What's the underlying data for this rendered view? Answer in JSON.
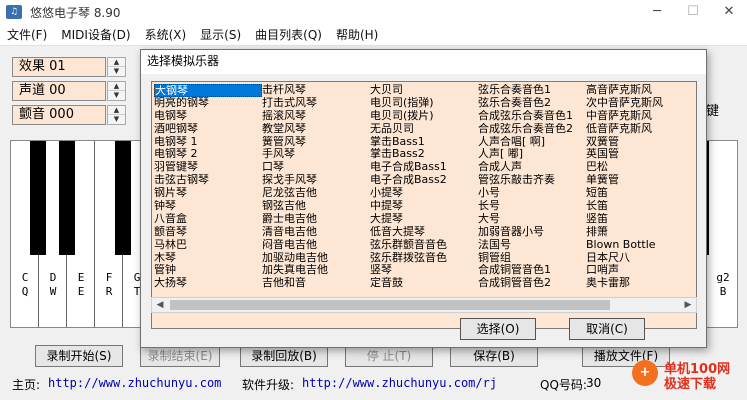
{
  "window": {
    "title": "悠悠电子琴 8.90",
    "app_icon": "piano-app-icon"
  },
  "menu": [
    "文件(F)",
    "MIDI设备(D)",
    "系统(X)",
    "显示(S)",
    "曲目列表(Q)",
    "帮助(H)"
  ],
  "controls": [
    {
      "label": "效果",
      "value": "01"
    },
    {
      "label": "声道",
      "value": "00"
    },
    {
      "label": "颤音",
      "value": "000"
    }
  ],
  "right_edge_text": "键",
  "keys": [
    {
      "note": "C",
      "key": "Q"
    },
    {
      "note": "D",
      "key": "W"
    },
    {
      "note": "E",
      "key": "E"
    },
    {
      "note": "F",
      "key": "R"
    },
    {
      "note": "G",
      "key": "T"
    }
  ],
  "right_key": {
    "note": "g2",
    "key": "B"
  },
  "dialog": {
    "title": "选择模拟乐器",
    "columns": [
      [
        "大钢琴",
        "明亮的钢琴",
        "电钢琴",
        "酒吧钢琴",
        "电钢琴 1",
        "电钢琴 2",
        "羽管键琴",
        "击弦古钢琴",
        "钢片琴",
        "钟琴",
        "八音盒",
        "颤音琴",
        "马林巴",
        "木琴",
        "管钟",
        "大扬琴"
      ],
      [
        "击杆风琴",
        "打击式风琴",
        "摇滚风琴",
        "教堂风琴",
        "簧管风琴",
        "手风琴",
        "口琴",
        "探戈手风琴",
        "尼龙弦吉他",
        "钢弦吉他",
        "爵士电吉他",
        "清音电吉他",
        "闷音电吉他",
        "加驱动电吉他",
        "加失真电吉他",
        "吉他和音"
      ],
      [
        "大贝司",
        "电贝司(指弹)",
        "电贝司(拨片)",
        "无品贝司",
        "掌击Bass1",
        "掌击Bass2",
        "电子合成Bass1",
        "电子合成Bass2",
        "小提琴",
        "中提琴",
        "大提琴",
        "低音大提琴",
        "弦乐群颤音音色",
        "弦乐群拨弦音色",
        "竖琴",
        "定音鼓"
      ],
      [
        "弦乐合奏音色1",
        "弦乐合奏音色2",
        "合成弦乐合奏音色1",
        "合成弦乐合奏音色2",
        "人声合唱[ 啊]",
        "人声[ 嘟]",
        "合成人声",
        "管弦乐敲击齐奏",
        "小号",
        "长号",
        "大号",
        "加弱音器小号",
        "法国号",
        "铜管组",
        "合成铜管音色1",
        "合成铜管音色2"
      ],
      [
        "高音萨克斯风",
        "次中音萨克斯风",
        "中音萨克斯风",
        "低音萨克斯风",
        "双簧管",
        "英国管",
        "巴松",
        "单簧管",
        "短笛",
        "长笛",
        "竖笛",
        "排箫",
        "Blown Bottle",
        "日本尺八",
        "口哨声",
        "奥卡雷那"
      ]
    ],
    "selected": "大钢琴",
    "ok_label": "选择(O)",
    "cancel_label": "取消(C)"
  },
  "buttons": [
    {
      "label": "录制开始(S)",
      "enabled": true
    },
    {
      "label": "录制结束(E)",
      "enabled": false
    },
    {
      "label": "录制回放(B)",
      "enabled": true
    },
    {
      "label": "停 止(T)",
      "enabled": false
    },
    {
      "label": "保存(B)",
      "enabled": true
    },
    {
      "label": "播放文件(F)",
      "enabled": true
    }
  ],
  "status": {
    "home_label": "主页:",
    "home_url": "http://www.zhuchunyu.com",
    "upgrade_label": "软件升级:",
    "upgrade_url": "http://www.zhuchunyu.com/rj",
    "qq_label": "QQ号码:",
    "qq_value": "30"
  },
  "watermark": {
    "line1": "单机100网",
    "line2": "极速下载"
  },
  "colors": {
    "list_bg": "#fde6d3",
    "selection": "#0078d7",
    "link": "#0000b0"
  }
}
